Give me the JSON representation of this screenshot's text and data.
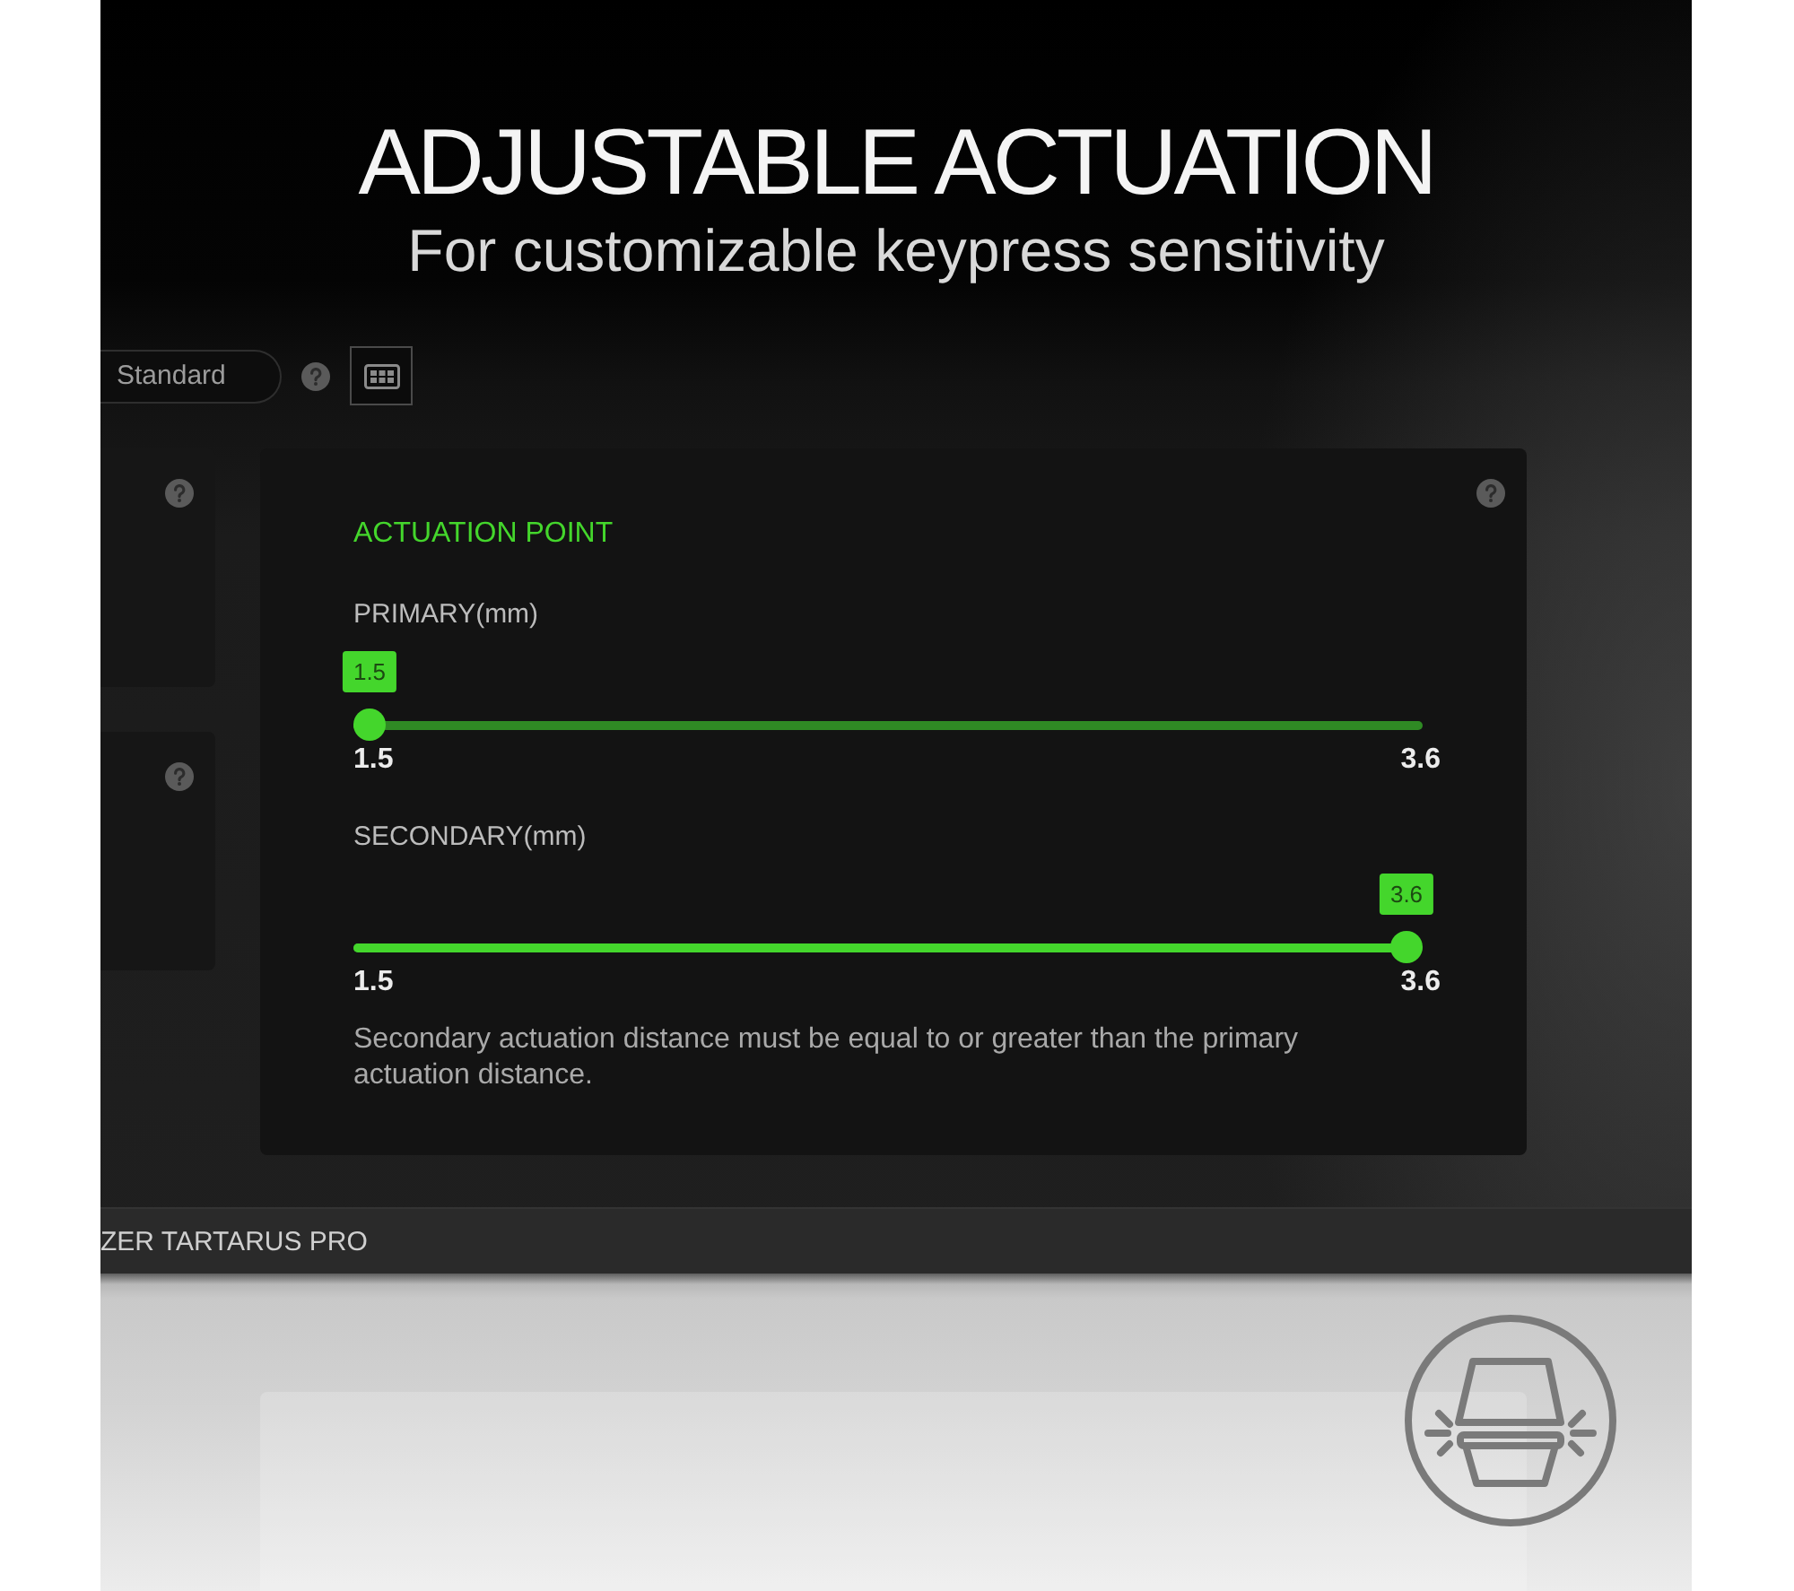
{
  "banner": {
    "title": "ADJUSTABLE ACTUATION",
    "subtitle": "For customizable keypress sensitivity"
  },
  "toolbar": {
    "mode_dropdown": {
      "value": "Standard"
    }
  },
  "actuation_panel": {
    "title": "ACTUATION POINT",
    "sliders": [
      {
        "label": "PRIMARY(mm)",
        "value_badge": "1.5",
        "level": 0,
        "min_label": "1.5",
        "max_label": "3.6"
      },
      {
        "label": "SECONDARY(mm)",
        "value_badge": "3.6",
        "level": 1,
        "min_label": "1.5",
        "max_label": "3.6"
      }
    ],
    "note": "Secondary actuation distance must be equal to or greater than the primary actuation distance."
  },
  "device_bar": {
    "name": "ZER TARTARUS PRO"
  }
}
